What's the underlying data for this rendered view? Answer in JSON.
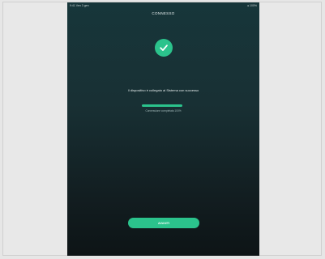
{
  "statusbar": {
    "left": "9:41 Ven 3 gen",
    "right": "● 100%"
  },
  "header": {
    "title": "CONNESSO"
  },
  "status": {
    "message": "Il dispositivo è collegato al Sistema con successo",
    "progress_caption": "Connessione completata 100%",
    "progress_value": 1.0
  },
  "actions": {
    "next_label": "AVANTI"
  },
  "colors": {
    "accent": "#2bc38c",
    "background_top": "#17363a",
    "background_bottom": "#0d1416"
  },
  "icons": {
    "success": "check-circle-icon"
  }
}
